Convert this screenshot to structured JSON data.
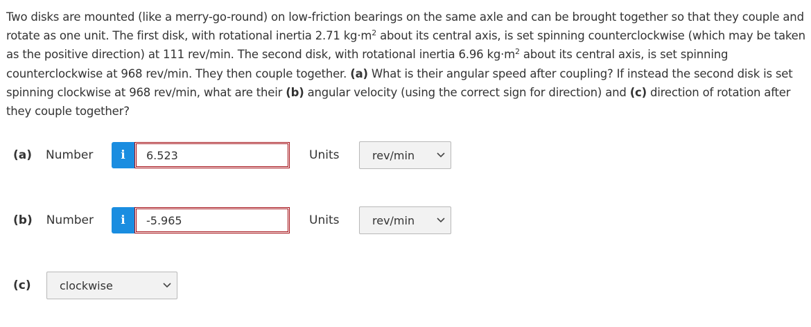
{
  "question": {
    "seg1": "Two disks are mounted (like a merry-go-round) on low-friction bearings on the same axle and can be brought together so that they couple and rotate as one unit. The first disk, with rotational inertia 2.71 kg·m",
    "sup1": "2",
    "seg2": " about its central axis, is set spinning counterclockwise (which may be taken as the positive direction) at 111 rev/min. The second disk, with rotational inertia 6.96 kg·m",
    "sup2": "2",
    "seg3": " about its central axis, is set spinning counterclockwise at 968 rev/min. They then couple together. ",
    "bold_a": "(a)",
    "seg4": " What is their angular speed after coupling? If instead the second disk is set spinning clockwise at 968 rev/min, what are their ",
    "bold_b": "(b)",
    "seg5": " angular velocity (using the correct sign for direction) and ",
    "bold_c": "(c)",
    "seg6": " direction of rotation after they couple together?"
  },
  "part_a": {
    "letter": "(a)",
    "label": "Number",
    "info_icon_glyph": "i",
    "value": "6.523",
    "units_label": "Units",
    "units_selected": "rev/min"
  },
  "part_b": {
    "letter": "(b)",
    "label": "Number",
    "info_icon_glyph": "i",
    "value": "-5.965",
    "units_label": "Units",
    "units_selected": "rev/min"
  },
  "part_c": {
    "letter": "(c)",
    "selected": "clockwise"
  },
  "colors": {
    "info_icon": "#1a8de0",
    "input_border": "#a30b12",
    "select_bg": "#f2f2f2",
    "text": "#333333"
  },
  "icons": {
    "info": "info-icon",
    "dropdown": "chevron-down-icon"
  }
}
